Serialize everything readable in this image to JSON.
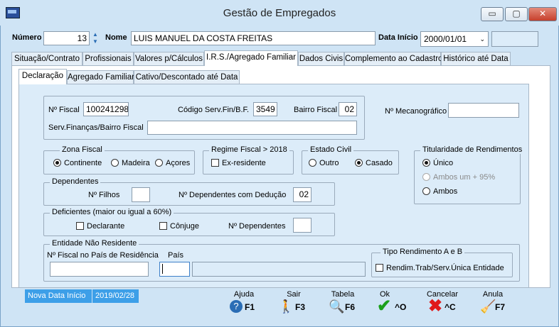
{
  "window": {
    "title": "Gestão de Empregados",
    "minimize": "▭",
    "maximize": "▢",
    "close": "✕"
  },
  "header": {
    "numero_label": "Número",
    "numero_value": "13",
    "nome_label": "Nome",
    "nome_value": "LUIS MANUEL DA COSTA FREITAS",
    "data_inicio_label": "Data Início",
    "data_inicio_value": "2000/01/01"
  },
  "main_tabs": [
    "Situação/Contrato",
    "Profissionais",
    "Valores p/Cálculos",
    "I.R.S./Agregado Familiar",
    "Dados Civis",
    "Complemento ao Cadastro",
    "Histórico até Data"
  ],
  "main_tab_active": "I.R.S./Agregado Familiar",
  "sub_tabs": [
    "Declaração",
    "Agregado Familiar",
    "Cativo/Descontado até Data"
  ],
  "sub_tab_active": "Declaração",
  "fiscal": {
    "nif_label": "Nº Fiscal",
    "nif_value": "100241298",
    "codigo_label": "Código Serv.Fin/B.F.",
    "codigo_value": "3549",
    "bairro_label": "Bairro Fiscal",
    "bairro_value": "02",
    "servfin_label": "Serv.Finanças/Bairro Fiscal",
    "servfin_value": "",
    "mecanografico_label": "Nº Mecanográfico",
    "mecanografico_value": ""
  },
  "zona_fiscal": {
    "title": "Zona Fiscal",
    "options": [
      "Continente",
      "Madeira",
      "Açores"
    ],
    "selected": "Continente"
  },
  "regime_fiscal": {
    "title": "Regime Fiscal > 2018",
    "checkbox": "Ex-residente"
  },
  "estado_civil": {
    "title": "Estado Civil",
    "options": [
      "Outro",
      "Casado"
    ],
    "selected": "Casado"
  },
  "titularidade": {
    "title": "Titularidade de Rendimentos",
    "options": [
      "Único",
      "Ambos um + 95%",
      "Ambos"
    ],
    "selected": "Único"
  },
  "dependentes": {
    "title": "Dependentes",
    "filhos_label": "Nº Filhos",
    "filhos_value": "",
    "deducao_label": "Nº Dependentes com Dedução",
    "deducao_value": "02"
  },
  "deficientes": {
    "title": "Deficientes (maior ou igual a 60%)",
    "declarante": "Declarante",
    "conjuge": "Cônjuge",
    "dependentes_label": "Nº Dependentes",
    "dependentes_value": ""
  },
  "nao_residente": {
    "title": "Entidade Não Residente",
    "nif_label": "Nº Fiscal no País de Residência",
    "pais_label": "País",
    "nif_value": "",
    "pais_value": "",
    "pais_desc": ""
  },
  "tipo_rendimento": {
    "title": "Tipo Rendimento A e B",
    "checkbox": "Rendim.Trab/Serv.Única Entidade"
  },
  "status": {
    "nova_data_label": "Nova Data Início",
    "nova_data_value": "2019/02/28"
  },
  "fkeys": [
    {
      "caption": "Ajuda",
      "key": "F1",
      "icon": "help-icon"
    },
    {
      "caption": "Sair",
      "key": "F3",
      "icon": "exit-icon"
    },
    {
      "caption": "Tabela",
      "key": "F6",
      "icon": "table-search-icon"
    },
    {
      "caption": "Ok",
      "key": "^O",
      "icon": "check-icon"
    },
    {
      "caption": "Cancelar",
      "key": "^C",
      "icon": "cancel-icon"
    },
    {
      "caption": "Anula",
      "key": "F7",
      "icon": "erase-icon"
    }
  ],
  "colors": {
    "ok": "#1aa01a",
    "cancel": "#e01a1a",
    "help": "#2a6db5",
    "status_bg": "#3d9fe8"
  }
}
